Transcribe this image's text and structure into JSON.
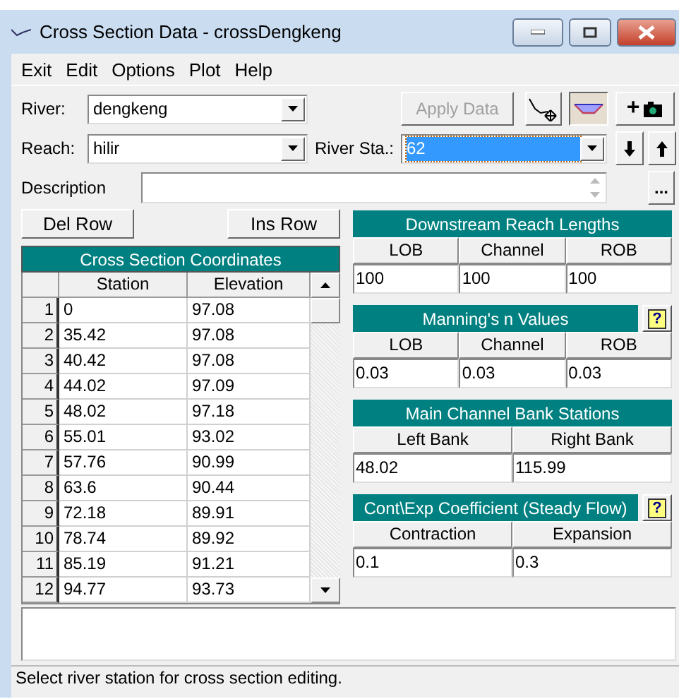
{
  "window": {
    "title": "Cross Section Data - crossDengkeng"
  },
  "menu": [
    "Exit",
    "Edit",
    "Options",
    "Plot",
    "Help"
  ],
  "river": {
    "label": "River:",
    "value": "dengkeng"
  },
  "apply_button": {
    "label": "Apply Data",
    "disabled": true
  },
  "tool_buttons": [
    {
      "kind": "plot",
      "pressed": false
    },
    {
      "kind": "section",
      "pressed": true
    },
    {
      "kind": "add-picture",
      "label": "+",
      "pressed": false
    }
  ],
  "reach": {
    "label": "Reach:",
    "value": "hilir"
  },
  "river_station": {
    "label": "River Sta.:",
    "value": "62",
    "selected": true
  },
  "description": {
    "label": "Description",
    "more": "..."
  },
  "row_buttons": [
    "Del Row",
    "Ins Row"
  ],
  "coordinates": {
    "title": "Cross Section Coordinates",
    "columns": [
      "Station",
      "Elevation"
    ],
    "rows": [
      {
        "number": "1",
        "station": "0",
        "elevation": "97.08"
      },
      {
        "number": "2",
        "station": "35.42",
        "elevation": "97.08"
      },
      {
        "number": "3",
        "station": "40.42",
        "elevation": "97.08"
      },
      {
        "number": "4",
        "station": "44.02",
        "elevation": "97.09"
      },
      {
        "number": "5",
        "station": "48.02",
        "elevation": "97.18"
      },
      {
        "number": "6",
        "station": "55.01",
        "elevation": "93.02"
      },
      {
        "number": "7",
        "station": "57.76",
        "elevation": "90.99"
      },
      {
        "number": "8",
        "station": "63.6",
        "elevation": "90.44"
      },
      {
        "number": "9",
        "station": "72.18",
        "elevation": "89.91"
      },
      {
        "number": "10",
        "station": "78.74",
        "elevation": "89.92"
      },
      {
        "number": "11",
        "station": "85.19",
        "elevation": "91.21"
      },
      {
        "number": "12",
        "station": "94.77",
        "elevation": "93.73"
      }
    ]
  },
  "panels": [
    {
      "title": "Downstream Reach Lengths",
      "columns": [
        "LOB",
        "Channel",
        "ROB"
      ],
      "values": [
        "100",
        "100",
        "100"
      ]
    },
    {
      "title": "Manning's n Values",
      "help": "?",
      "columns": [
        "LOB",
        "Channel",
        "ROB"
      ],
      "values": [
        "0.03",
        "0.03",
        "0.03"
      ]
    },
    {
      "title": "Main Channel Bank Stations",
      "columns": [
        "Left Bank",
        "Right Bank"
      ],
      "values": [
        "48.02",
        "115.99"
      ]
    },
    {
      "title": "Cont\\Exp Coefficient (Steady Flow)",
      "help": "?",
      "columns": [
        "Contraction",
        "Expansion"
      ],
      "values": [
        "0.1",
        "0.3"
      ]
    }
  ],
  "status_bar": "Select river station for cross section editing."
}
